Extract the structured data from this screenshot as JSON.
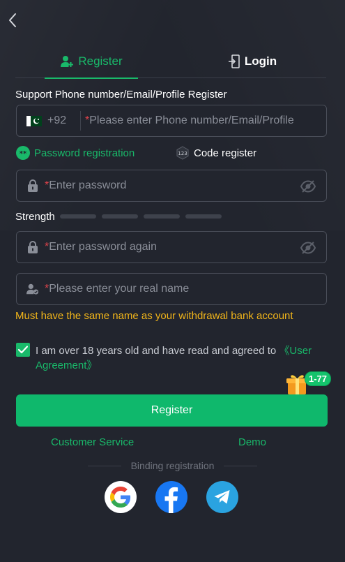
{
  "nav": {
    "back_icon": "chevron-left-icon"
  },
  "tabs": {
    "register": {
      "label": "Register",
      "icon": "user-add-icon",
      "active": true
    },
    "login": {
      "label": "Login",
      "icon": "login-door-icon",
      "active": false
    }
  },
  "form": {
    "support_label": "Support Phone number/Email/Profile Register",
    "phone": {
      "flag_icon": "pakistan-flag-icon",
      "country_code": "+92",
      "required_mark": "*",
      "placeholder": "Please enter Phone number/Email/Profile",
      "value": ""
    },
    "modes": {
      "password": {
        "label": "Password registration",
        "icon": "password-dots-icon",
        "active": true
      },
      "code": {
        "label": "Code register",
        "icon": "code-123-icon",
        "active": false
      }
    },
    "password": {
      "required_mark": "*",
      "placeholder": "Enter password",
      "icon": "lock-icon",
      "eye_icon": "eye-off-icon"
    },
    "strength": {
      "label": "Strength",
      "level": 0,
      "bars": 4
    },
    "password_again": {
      "required_mark": "*",
      "placeholder": "Enter password again",
      "icon": "lock-icon",
      "eye_icon": "eye-off-icon"
    },
    "real_name": {
      "required_mark": "*",
      "placeholder": "Please enter your real name",
      "icon": "user-verified-icon"
    },
    "name_warning": "Must have the same name as your withdrawal bank account",
    "agreement": {
      "checked": true,
      "text": "I am over 18 years old and have read and agreed to ",
      "link": "《User Agreement》"
    }
  },
  "promo": {
    "icon": "gift-icon",
    "badge": "1-77"
  },
  "register_button": "Register",
  "links": {
    "customer_service": "Customer Service",
    "demo": "Demo"
  },
  "binding": {
    "label": "Binding registration",
    "providers": [
      "google-icon",
      "facebook-icon",
      "telegram-icon"
    ]
  },
  "colors": {
    "background": "#22252e",
    "accent": "#19b96a",
    "warning": "#f0b41a",
    "required": "#e1434b",
    "border": "#4a4e59"
  }
}
